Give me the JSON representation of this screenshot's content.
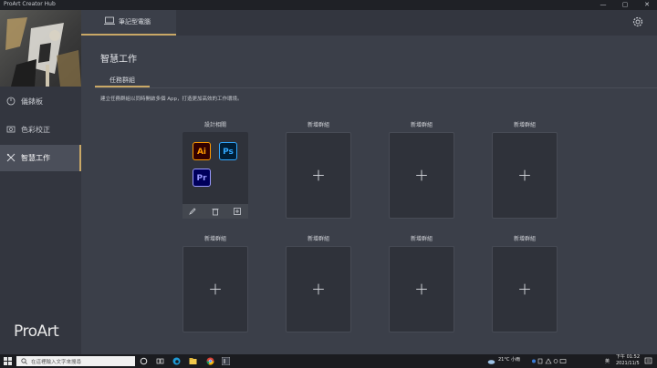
{
  "window": {
    "title": "ProArt Creator Hub",
    "controls": {
      "minimize": "—",
      "maximize": "▢",
      "close": "✕"
    }
  },
  "sidebar": {
    "items": [
      {
        "label": "儀錶板",
        "icon": "dashboard-icon"
      },
      {
        "label": "色彩校正",
        "icon": "color-calibration-icon"
      },
      {
        "label": "智慧工作",
        "icon": "smart-work-icon",
        "active": true
      }
    ],
    "brand": "ProArt"
  },
  "topbar": {
    "device_tab": "筆記型電腦",
    "settings_icon": "gear-icon"
  },
  "page": {
    "title": "智慧工作",
    "subtab": "任務群組",
    "description": "建立任務群組以同時開啟多個 App，打造更加高效的工作環境。"
  },
  "groups": [
    {
      "label": "設計相關",
      "apps": [
        {
          "name": "Ai",
          "bg": "#330000",
          "fg": "#ff9a00"
        },
        {
          "name": "Ps",
          "bg": "#001e36",
          "fg": "#31a8ff"
        },
        {
          "name": "Pr",
          "bg": "#00005b",
          "fg": "#9999ff"
        }
      ],
      "tools": [
        "edit-icon",
        "trash-icon",
        "launch-icon"
      ]
    },
    {
      "label": "新增群組"
    },
    {
      "label": "新增群組"
    },
    {
      "label": "新增群組"
    },
    {
      "label": "新增群組"
    },
    {
      "label": "新增群組"
    },
    {
      "label": "新增群組"
    },
    {
      "label": "新增群組"
    }
  ],
  "taskbar": {
    "search_placeholder": "在這裡輸入文字來搜尋",
    "weather": "21°C 小雨",
    "lang": "英",
    "time": "下午 01:52",
    "date": "2021/11/5"
  },
  "colors": {
    "accent": "#c9a866",
    "bg": "#3b3f49",
    "card": "#2f323a"
  }
}
